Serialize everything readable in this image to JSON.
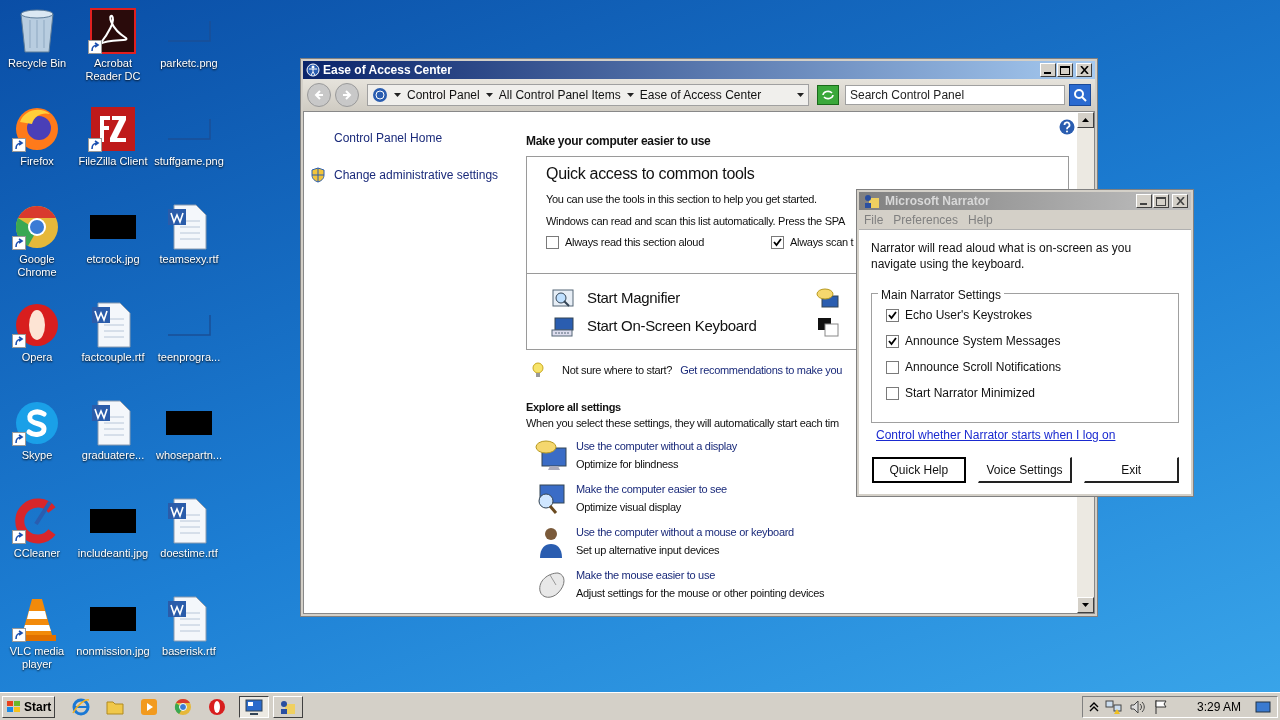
{
  "desktop_icons": [
    {
      "label": "Recycle Bin",
      "kind": "recycle",
      "shortcut": false
    },
    {
      "label": "Acrobat Reader DC",
      "kind": "acrobat",
      "shortcut": true
    },
    {
      "label": "parketc.png",
      "kind": "image",
      "shortcut": false
    },
    {
      "label": "Firefox",
      "kind": "firefox",
      "shortcut": true
    },
    {
      "label": "FileZilla Client",
      "kind": "filezilla",
      "shortcut": true
    },
    {
      "label": "stuffgame.png",
      "kind": "image",
      "shortcut": false
    },
    {
      "label": "Google Chrome",
      "kind": "chrome",
      "shortcut": true
    },
    {
      "label": "etcrock.jpg",
      "kind": "black",
      "shortcut": false
    },
    {
      "label": "teamsexy.rtf",
      "kind": "word",
      "shortcut": false
    },
    {
      "label": "Opera",
      "kind": "opera",
      "shortcut": true
    },
    {
      "label": "factcouple.rtf",
      "kind": "word",
      "shortcut": false
    },
    {
      "label": "teenprogra...",
      "kind": "image",
      "shortcut": false
    },
    {
      "label": "Skype",
      "kind": "skype",
      "shortcut": true
    },
    {
      "label": "graduatere...",
      "kind": "word",
      "shortcut": false
    },
    {
      "label": "whosepartn...",
      "kind": "black",
      "shortcut": false
    },
    {
      "label": "CCleaner",
      "kind": "ccleaner",
      "shortcut": true
    },
    {
      "label": "includeanti.jpg",
      "kind": "black",
      "shortcut": false
    },
    {
      "label": "doestime.rtf",
      "kind": "word",
      "shortcut": false
    },
    {
      "label": "VLC media player",
      "kind": "vlc",
      "shortcut": true
    },
    {
      "label": "nonmission.jpg",
      "kind": "black",
      "shortcut": false
    },
    {
      "label": "baserisk.rtf",
      "kind": "word",
      "shortcut": false
    }
  ],
  "ease_window": {
    "title": "Ease of Access Center",
    "address": [
      "Control Panel",
      "All Control Panel Items",
      "Ease of Access Center"
    ],
    "search": {
      "placeholder": "Search Control Panel"
    },
    "nav": [
      {
        "label": "Control Panel Home",
        "kind": "link"
      },
      {
        "label": "Change administrative settings",
        "kind": "shield"
      }
    ],
    "heading": "Make your computer easier to use",
    "quick": {
      "title": "Quick access to common tools",
      "lines": [
        "You can use the tools in this section to help you get started.",
        "Windows can read and scan this list automatically.  Press the SPA"
      ],
      "checkboxes": [
        {
          "label": "Always read this section aloud",
          "checked": false
        },
        {
          "label": "Always scan t",
          "checked": true
        }
      ],
      "tools": [
        {
          "label": "Start Magnifier",
          "kind": "magnifier"
        },
        {
          "kind": "narrator"
        },
        {
          "label": "Start On-Screen Keyboard",
          "kind": "keyboard"
        },
        {
          "kind": "contrast"
        }
      ]
    },
    "hint": {
      "text": "Not sure where to start?",
      "link": "Get recommendations to make you"
    },
    "explore": {
      "title": "Explore all settings",
      "text": "When you select these settings, they will automatically start each tim",
      "items": [
        {
          "link": "Use the computer without a display",
          "desc": "Optimize for blindness",
          "kind": "display"
        },
        {
          "link": "Make the computer easier to see",
          "desc": "Optimize visual display",
          "kind": "see"
        },
        {
          "link": "Use the computer without a mouse or keyboard",
          "desc": "Set up alternative input devices",
          "kind": "person"
        },
        {
          "link": "Make the mouse easier to use",
          "desc": "Adjust settings for the mouse or other pointing devices",
          "kind": "mouse"
        }
      ]
    }
  },
  "narrator": {
    "title": "Microsoft Narrator",
    "menu": [
      "File",
      "Preferences",
      "Help"
    ],
    "intro": "Narrator will read aloud what is on-screen as you navigate using the keyboard.",
    "group": "Main Narrator Settings",
    "options": [
      {
        "label": "Echo User's Keystrokes",
        "checked": true
      },
      {
        "label": "Announce System Messages",
        "checked": true
      },
      {
        "label": "Announce Scroll Notifications",
        "checked": false
      },
      {
        "label": "Start Narrator Minimized",
        "checked": false
      }
    ],
    "link": "Control whether Narrator starts when I log on",
    "buttons": [
      "Quick Help",
      "Voice Settings",
      "Exit"
    ]
  },
  "taskbar": {
    "start": "Start",
    "launchers": [
      {
        "kind": "ie"
      },
      {
        "kind": "folder"
      },
      {
        "kind": "media"
      },
      {
        "kind": "chrome"
      },
      {
        "kind": "opera"
      }
    ],
    "tasks": [
      {
        "kind": "control-panel",
        "selected": true
      },
      {
        "kind": "narrator",
        "selected": false
      }
    ],
    "tray": [
      {
        "kind": "arrow"
      },
      {
        "kind": "network"
      },
      {
        "kind": "volume"
      },
      {
        "kind": "flag"
      }
    ],
    "clock": "3:29 AM"
  }
}
